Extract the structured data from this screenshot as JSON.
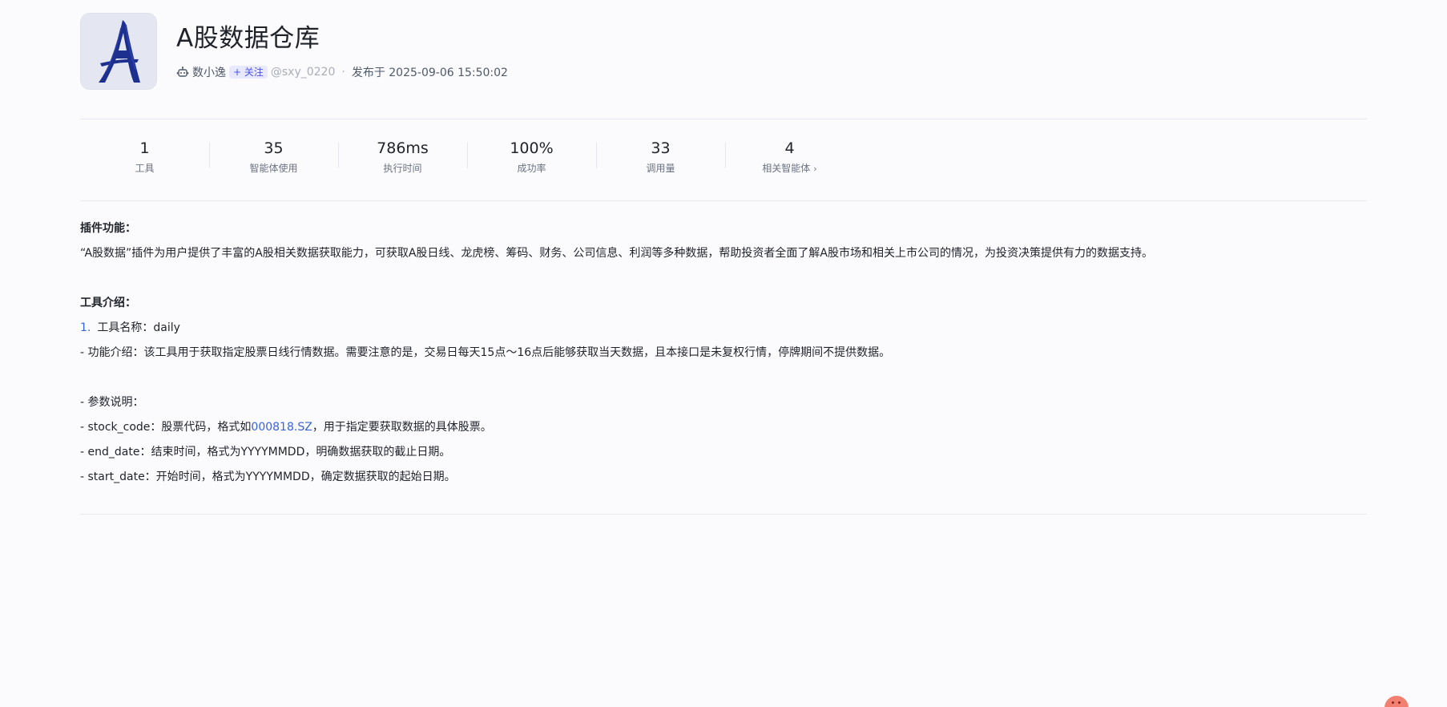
{
  "plugin": {
    "title": "A股数据仓库",
    "logo_icon": "brush-letter-a-logo",
    "author": "数小逸",
    "follow_label": "+ 关注",
    "handle": "@sxy_0220",
    "separator": "·",
    "published": "发布于 2025-09-06 15:50:02"
  },
  "stats": [
    {
      "value": "1",
      "label": "工具"
    },
    {
      "value": "35",
      "label": "智能体使用"
    },
    {
      "value": "786ms",
      "label": "执行时间"
    },
    {
      "value": "100%",
      "label": "成功率"
    },
    {
      "value": "33",
      "label": "调用量"
    },
    {
      "value": "4",
      "label": "相关智能体",
      "chevron": "›"
    }
  ],
  "content": {
    "feature_title": "插件功能：",
    "feature_desc": "“A股数据”插件为用户提供了丰富的A股相关数据获取能力，可获取A股日线、龙虎榜、筹码、财务、公司信息、利润等多种数据，帮助投资者全面了解A股市场和相关上市公司的情况，为投资决策提供有力的数据支持。",
    "tools_title": "工具介绍：",
    "tool_number": "1.",
    "tool_name": "工具名称：daily",
    "tool_func": "- 功能介绍：该工具用于获取指定股票日线行情数据。需要注意的是，交易日每天15点～16点后能够获取当天数据，且本接口是未复权行情，停牌期间不提供数据。",
    "params_title": "- 参数说明：",
    "param_stock_prefix": "- stock_code：股票代码，格式如",
    "param_stock_link": "000818.SZ",
    "param_stock_suffix": "，用于指定要获取数据的具体股票。",
    "param_end": "- end_date：结束时间，格式为YYYYMMDD，明确数据获取的截止日期。",
    "param_start": "- start_date：开始时间，格式为YYYYMMDD，确定数据获取的起始日期。"
  },
  "colors": {
    "accent": "#4d53e8",
    "link": "#3a63d6",
    "logo_bg": "#e4e7f2",
    "logo_ink": "#1d2f8f"
  }
}
